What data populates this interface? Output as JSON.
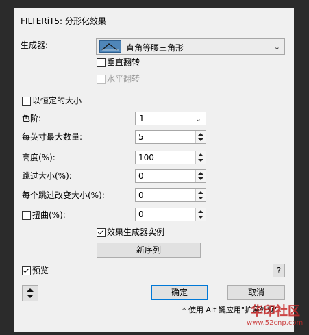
{
  "window": {
    "title": "FILTERiT5: 分形化效果"
  },
  "generator": {
    "label": "生成器:",
    "selected": "直角等腰三角形",
    "icon": "triangle-preview-icon"
  },
  "flip": {
    "vertical": "垂直翻转",
    "horizontal": "水平翻转",
    "vertical_checked": false,
    "horizontal_checked": false
  },
  "constant_size": {
    "label": "以恒定的大小",
    "checked": false
  },
  "levels": {
    "label": "色阶:",
    "value": "1"
  },
  "per_inch_max": {
    "label": "每英寸最大数量:",
    "value": "5"
  },
  "height": {
    "label": "高度(%):",
    "value": "100"
  },
  "skip_size": {
    "label": "跳过大小(%):",
    "value": "0"
  },
  "skip_change": {
    "label": "每个跳过改变大小(%):",
    "value": "0"
  },
  "twist": {
    "label": "扭曲(%):",
    "value": "0",
    "checked": false
  },
  "effect_instance": {
    "label": "效果生成器实例",
    "checked": true
  },
  "new_sequence": {
    "label": "新序列"
  },
  "preview": {
    "label": "预览",
    "checked": true
  },
  "help": {
    "label": "?"
  },
  "ok": {
    "label": "确定"
  },
  "cancel": {
    "label": "取消"
  },
  "hint": {
    "text": "* 使用 Alt 键应用\"扩展外观\""
  },
  "watermark": {
    "text1": "华印社区",
    "text2": "www.52cnp.com"
  }
}
